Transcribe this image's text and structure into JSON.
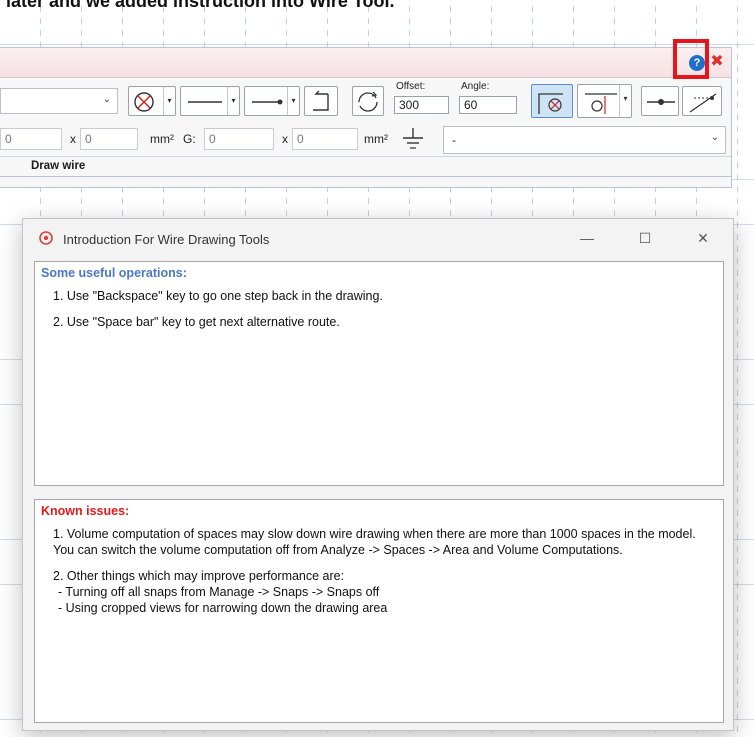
{
  "header_text": "later and we added instruction into Wire Tool.",
  "toolbar": {
    "help_icon_glyph": "?",
    "close_icon_glyph": "✖",
    "offset_label": "Offset:",
    "offset_value": "300",
    "angle_label": "Angle:",
    "angle_value": "60",
    "cross_section_a": "0",
    "cross_x1": "x",
    "cross_section_b": "0",
    "unit_1": "mm²",
    "g_label": "G:",
    "g_value": "0",
    "cross_x2": "x",
    "g_value_2": "0",
    "unit_2": "mm²",
    "ground_value": "-",
    "group_label": "Draw wire",
    "chevron": "⌄",
    "dropdown_arrow": "▾",
    "highlight_color": "#e8141c"
  },
  "dialog": {
    "title": "Introduction For Wire Drawing Tools",
    "minimize_glyph": "—",
    "maximize_glyph": "☐",
    "close_glyph": "✕",
    "useful": {
      "heading": "Some useful operations:",
      "heading_color": "#4a78c8",
      "items": [
        "1. Use \"Backspace\" key to go one step back in the drawing.",
        "2. Use \"Space bar\" key to get next alternative route."
      ]
    },
    "issues": {
      "heading": "Known issues:",
      "heading_color": "#e41a1a",
      "item1": "1. Volume computation of spaces may slow down wire drawing when there are more than 1000 spaces in the model. You can switch the volume computation off from Analyze -> Spaces -> Area and Volume Computations.",
      "item2": "2. Other things which may improve performance are:",
      "sub1": "- Turning off all snaps from Manage -> Snaps -> Snaps off",
      "sub2": "- Using cropped views for narrowing down the drawing area"
    }
  }
}
